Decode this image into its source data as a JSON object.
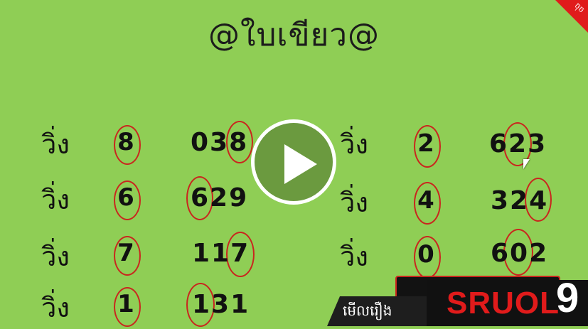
{
  "title": "@ใบเขียว@",
  "corner_badge": "ចុច",
  "rows_left": [
    {
      "label": "วิ่ง",
      "digit": "8",
      "number": "038"
    },
    {
      "label": "วิ่ง",
      "digit": "6",
      "number": "629"
    },
    {
      "label": "วิ่ง",
      "digit": "7",
      "number": "117"
    },
    {
      "label": "วิ่ง",
      "digit": "1",
      "number": "131"
    }
  ],
  "rows_right": [
    {
      "label": "วิ่ง",
      "digit": "2",
      "number": "623"
    },
    {
      "label": "วิ่ง",
      "digit": "4",
      "number": "324"
    },
    {
      "label": "วิ่ง",
      "digit": "0",
      "number": "602"
    }
  ],
  "watch_label": "មើលរឿង",
  "brand": {
    "text": "SRUOL",
    "suffix": "9"
  },
  "colors": {
    "background": "#8fce55",
    "ring": "#c9261e",
    "brand_red": "#e11b1b"
  }
}
